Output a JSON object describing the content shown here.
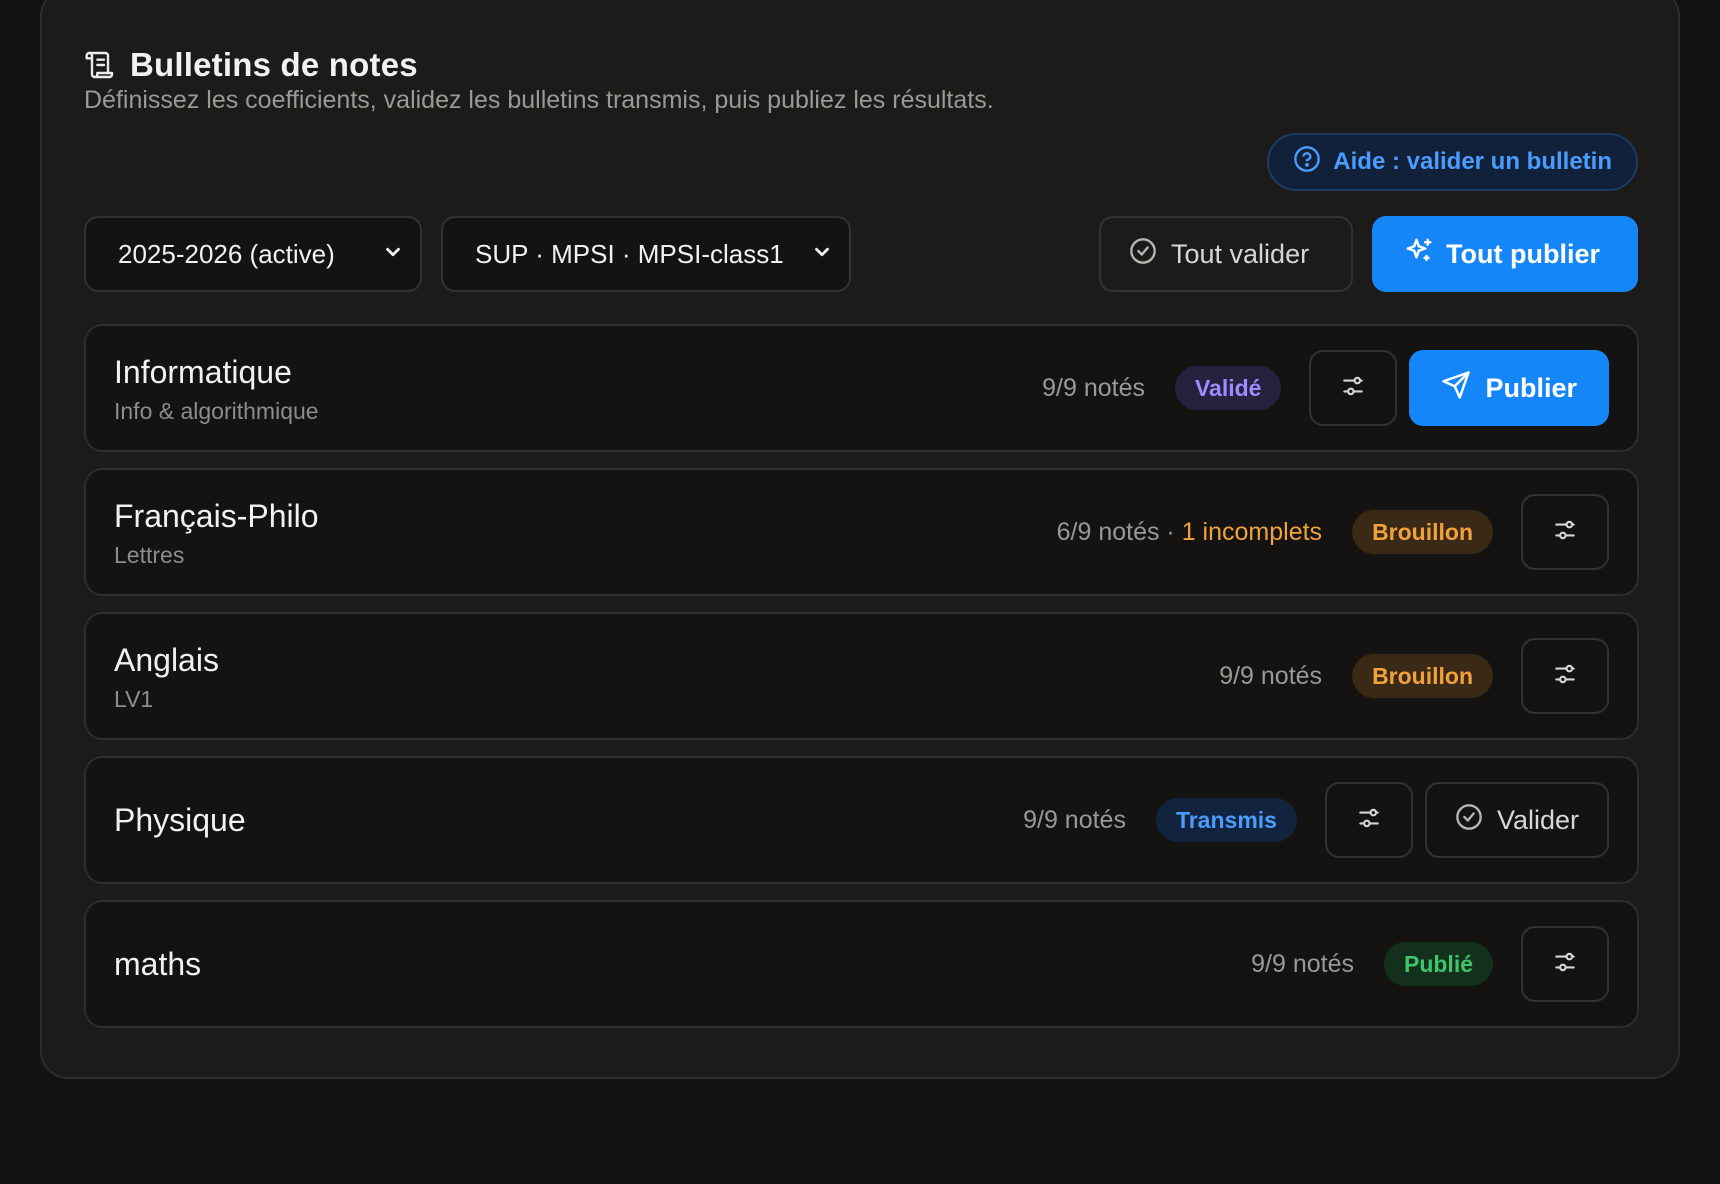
{
  "header": {
    "title": "Bulletins de notes",
    "icon": "scroll-icon",
    "subtitle": "Définissez les coefficients, validez les bulletins transmis, puis publiez les résultats."
  },
  "help": {
    "label": "Aide : valider un bulletin",
    "icon": "help-circle-icon"
  },
  "filters": {
    "year": "2025-2026 (active)",
    "class": "SUP · MPSI · MPSI-class1"
  },
  "actions": {
    "validate_all": "Tout valider",
    "publish_all": "Tout publier"
  },
  "colors": {
    "accent": "#1486f7",
    "status_valid": "#9b8cff",
    "status_draft": "#f0a23c",
    "status_sent": "#4a9cff",
    "status_published": "#3ec56a"
  },
  "subjects": [
    {
      "name": "Informatique",
      "sub": "Info & algorithmique",
      "count": "9/9 notés",
      "incomplete": "",
      "status": "Validé",
      "action": "Publier"
    },
    {
      "name": "Français-Philo",
      "sub": "Lettres",
      "count": "6/9 notés",
      "incomplete": "1 incomplets",
      "status": "Brouillon",
      "action": ""
    },
    {
      "name": "Anglais",
      "sub": "LV1",
      "count": "9/9 notés",
      "incomplete": "",
      "status": "Brouillon",
      "action": ""
    },
    {
      "name": "Physique",
      "sub": "",
      "count": "9/9 notés",
      "incomplete": "",
      "status": "Transmis",
      "action": "Valider"
    },
    {
      "name": "maths",
      "sub": "",
      "count": "9/9 notés",
      "incomplete": "",
      "status": "Publié",
      "action": ""
    }
  ]
}
